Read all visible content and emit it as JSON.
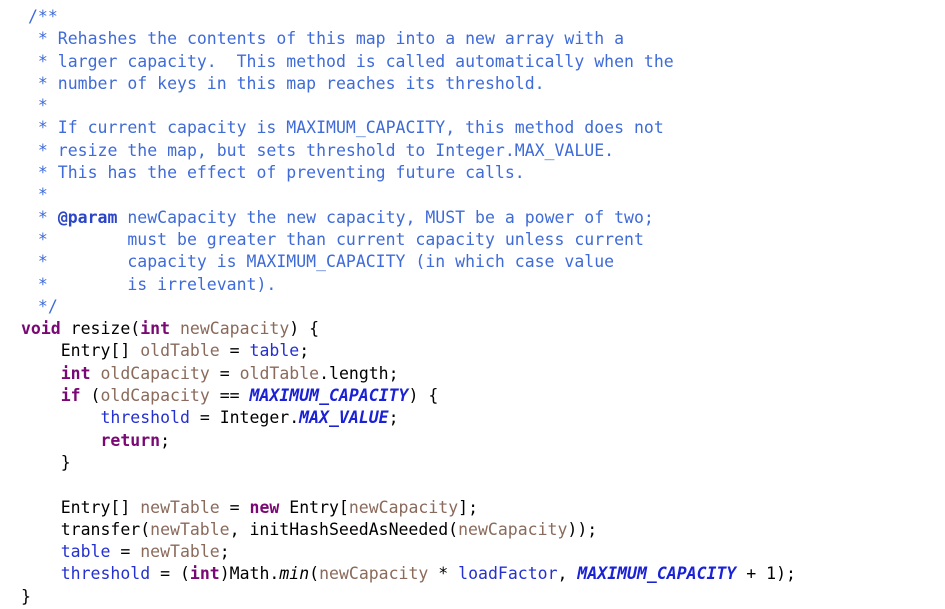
{
  "editor": {
    "kind": "source-code-viewer",
    "language": "Java",
    "background_color": "#ffffff",
    "font": "monospace",
    "colors": {
      "plain": "#000000",
      "comment": "#3F6BD8",
      "javadoc_tag": "#2B45C8",
      "keyword": "#7A0874",
      "field": "#2430CF",
      "static_constant": "#1B22D6",
      "local_variable": "#8A6A5B",
      "static_method": "#000000"
    }
  },
  "code": {
    "lines": [
      {
        "id": "line-1",
        "indent": 1,
        "tokens": [
          {
            "t": "/**",
            "c": "comment"
          }
        ]
      },
      {
        "id": "line-2",
        "indent": 1,
        "tokens": [
          {
            "t": " * Rehashes the contents of this map into a new array with a",
            "c": "comment"
          }
        ]
      },
      {
        "id": "line-3",
        "indent": 1,
        "tokens": [
          {
            "t": " * larger capacity.  This method is called automatically when the",
            "c": "comment"
          }
        ]
      },
      {
        "id": "line-4",
        "indent": 1,
        "tokens": [
          {
            "t": " * number of keys in this map reaches its threshold.",
            "c": "comment"
          }
        ]
      },
      {
        "id": "line-5",
        "indent": 1,
        "tokens": [
          {
            "t": " *",
            "c": "comment"
          }
        ]
      },
      {
        "id": "line-6",
        "indent": 1,
        "tokens": [
          {
            "t": " * If current capacity is MAXIMUM_CAPACITY, this method does not",
            "c": "comment"
          }
        ]
      },
      {
        "id": "line-7",
        "indent": 1,
        "tokens": [
          {
            "t": " * resize the map, but sets threshold to Integer.MAX_VALUE.",
            "c": "comment"
          }
        ]
      },
      {
        "id": "line-8",
        "indent": 1,
        "tokens": [
          {
            "t": " * This has the effect of preventing future calls.",
            "c": "comment"
          }
        ]
      },
      {
        "id": "line-9",
        "indent": 1,
        "tokens": [
          {
            "t": " *",
            "c": "comment"
          }
        ]
      },
      {
        "id": "line-10",
        "indent": 1,
        "tokens": [
          {
            "t": " * ",
            "c": "comment"
          },
          {
            "t": "@param",
            "c": "javadoc_tag"
          },
          {
            "t": " newCapacity the new capacity, MUST be a power of two;",
            "c": "comment"
          }
        ]
      },
      {
        "id": "line-11",
        "indent": 1,
        "tokens": [
          {
            "t": " *        must be greater than current capacity unless current",
            "c": "comment"
          }
        ]
      },
      {
        "id": "line-12",
        "indent": 1,
        "tokens": [
          {
            "t": " *        capacity is MAXIMUM_CAPACITY (in which case value",
            "c": "comment"
          }
        ]
      },
      {
        "id": "line-13",
        "indent": 1,
        "tokens": [
          {
            "t": " *        is irrelevant).",
            "c": "comment"
          }
        ]
      },
      {
        "id": "line-14",
        "indent": 1,
        "tokens": [
          {
            "t": " */",
            "c": "comment"
          }
        ]
      },
      {
        "id": "line-15",
        "indent": 0,
        "tokens": [
          {
            "t": "void",
            "c": "keyword"
          },
          {
            "t": " resize(",
            "c": "plain"
          },
          {
            "t": "int",
            "c": "keyword"
          },
          {
            "t": " ",
            "c": "plain"
          },
          {
            "t": "newCapacity",
            "c": "local"
          },
          {
            "t": ") {",
            "c": "plain"
          }
        ]
      },
      {
        "id": "line-16",
        "indent": 0,
        "tokens": [
          {
            "t": "    Entry[] ",
            "c": "plain"
          },
          {
            "t": "oldTable",
            "c": "local"
          },
          {
            "t": " = ",
            "c": "plain"
          },
          {
            "t": "table",
            "c": "field"
          },
          {
            "t": ";",
            "c": "plain"
          }
        ]
      },
      {
        "id": "line-17",
        "indent": 0,
        "tokens": [
          {
            "t": "    ",
            "c": "plain"
          },
          {
            "t": "int",
            "c": "keyword"
          },
          {
            "t": " ",
            "c": "plain"
          },
          {
            "t": "oldCapacity",
            "c": "local"
          },
          {
            "t": " = ",
            "c": "plain"
          },
          {
            "t": "oldTable",
            "c": "local"
          },
          {
            "t": ".length;",
            "c": "plain"
          }
        ]
      },
      {
        "id": "line-18",
        "indent": 0,
        "tokens": [
          {
            "t": "    ",
            "c": "plain"
          },
          {
            "t": "if",
            "c": "keyword"
          },
          {
            "t": " (",
            "c": "plain"
          },
          {
            "t": "oldCapacity",
            "c": "local"
          },
          {
            "t": " == ",
            "c": "plain"
          },
          {
            "t": "MAXIMUM_CAPACITY",
            "c": "static"
          },
          {
            "t": ") {",
            "c": "plain"
          }
        ]
      },
      {
        "id": "line-19",
        "indent": 0,
        "tokens": [
          {
            "t": "        ",
            "c": "plain"
          },
          {
            "t": "threshold",
            "c": "field"
          },
          {
            "t": " = Integer.",
            "c": "plain"
          },
          {
            "t": "MAX_VALUE",
            "c": "static"
          },
          {
            "t": ";",
            "c": "plain"
          }
        ]
      },
      {
        "id": "line-20",
        "indent": 0,
        "tokens": [
          {
            "t": "        ",
            "c": "plain"
          },
          {
            "t": "return",
            "c": "keyword"
          },
          {
            "t": ";",
            "c": "plain"
          }
        ]
      },
      {
        "id": "line-21",
        "indent": 0,
        "tokens": [
          {
            "t": "    }",
            "c": "plain"
          }
        ]
      },
      {
        "id": "line-22",
        "indent": 0,
        "tokens": [
          {
            "t": "",
            "c": "plain"
          }
        ]
      },
      {
        "id": "line-23",
        "indent": 0,
        "tokens": [
          {
            "t": "    Entry[] ",
            "c": "plain"
          },
          {
            "t": "newTable",
            "c": "local"
          },
          {
            "t": " = ",
            "c": "plain"
          },
          {
            "t": "new",
            "c": "keyword"
          },
          {
            "t": " Entry[",
            "c": "plain"
          },
          {
            "t": "newCapacity",
            "c": "local"
          },
          {
            "t": "];",
            "c": "plain"
          }
        ]
      },
      {
        "id": "line-24",
        "indent": 0,
        "tokens": [
          {
            "t": "    transfer(",
            "c": "plain"
          },
          {
            "t": "newTable",
            "c": "local"
          },
          {
            "t": ", initHashSeedAsNeeded(",
            "c": "plain"
          },
          {
            "t": "newCapacity",
            "c": "local"
          },
          {
            "t": "));",
            "c": "plain"
          }
        ]
      },
      {
        "id": "line-25",
        "indent": 0,
        "tokens": [
          {
            "t": "    ",
            "c": "plain"
          },
          {
            "t": "table",
            "c": "field"
          },
          {
            "t": " = ",
            "c": "plain"
          },
          {
            "t": "newTable",
            "c": "local"
          },
          {
            "t": ";",
            "c": "plain"
          }
        ]
      },
      {
        "id": "line-26",
        "indent": 0,
        "tokens": [
          {
            "t": "    ",
            "c": "plain"
          },
          {
            "t": "threshold",
            "c": "field"
          },
          {
            "t": " = (",
            "c": "plain"
          },
          {
            "t": "int",
            "c": "keyword"
          },
          {
            "t": ")Math.",
            "c": "plain"
          },
          {
            "t": "min",
            "c": "staticmethod"
          },
          {
            "t": "(",
            "c": "plain"
          },
          {
            "t": "newCapacity",
            "c": "local"
          },
          {
            "t": " * ",
            "c": "plain"
          },
          {
            "t": "loadFactor",
            "c": "field"
          },
          {
            "t": ", ",
            "c": "plain"
          },
          {
            "t": "MAXIMUM_CAPACITY",
            "c": "static"
          },
          {
            "t": " + 1);",
            "c": "plain"
          }
        ]
      },
      {
        "id": "line-27",
        "indent": 0,
        "tokens": [
          {
            "t": "}",
            "c": "plain"
          }
        ]
      }
    ]
  }
}
